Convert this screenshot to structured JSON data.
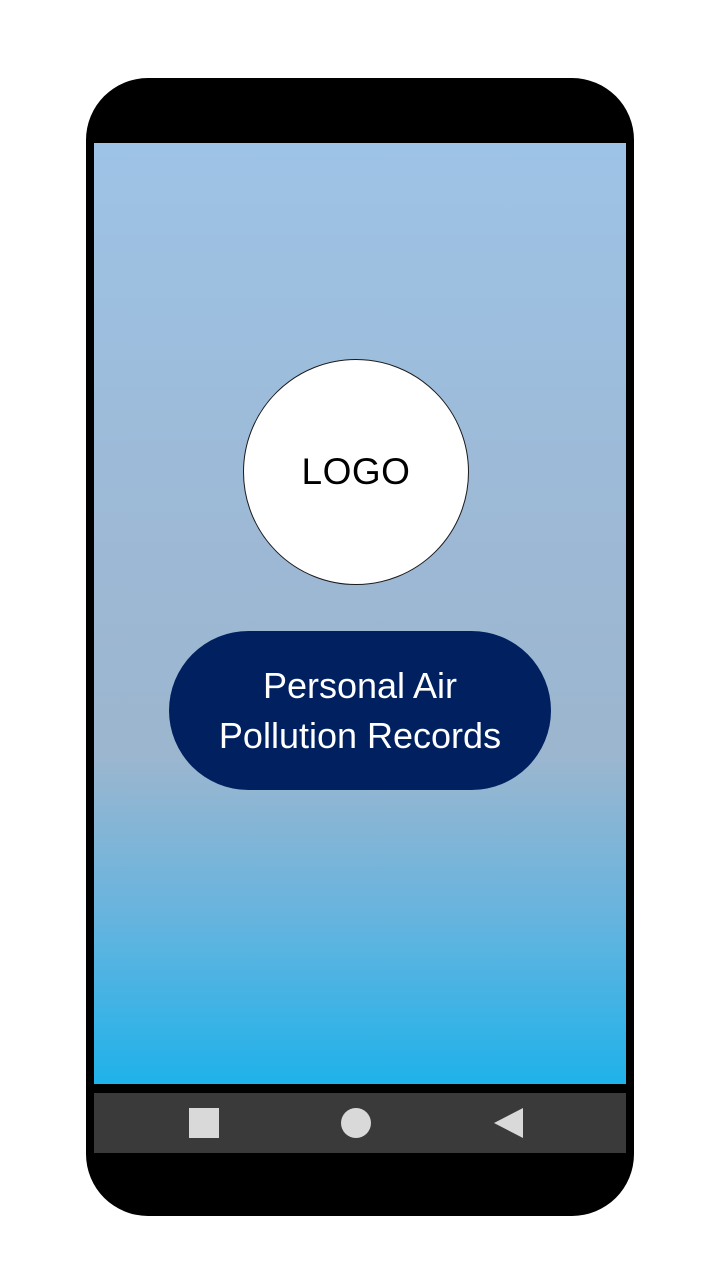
{
  "logo": {
    "text": "LOGO"
  },
  "title": {
    "line1": "Personal Air",
    "line2": "Pollution Records"
  },
  "navigation": {
    "recent_icon": "square-icon",
    "home_icon": "circle-icon",
    "back_icon": "back-triangle-icon"
  },
  "colors": {
    "phone_frame": "#000000",
    "screen_gradient_top": "#9dc3e6",
    "screen_gradient_bottom": "#1fb2ea",
    "title_background": "#002060",
    "title_text": "#ffffff",
    "nav_bar": "#3a3a3a",
    "nav_icons": "#d9d9d9"
  }
}
